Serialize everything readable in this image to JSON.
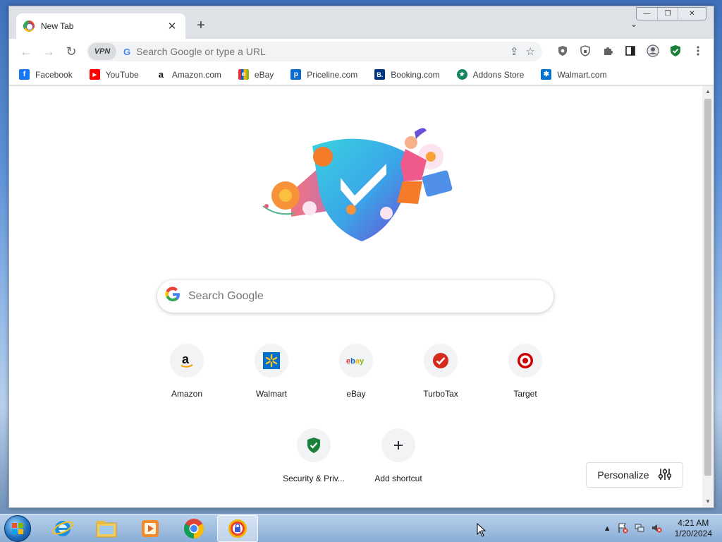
{
  "window": {
    "controls": {
      "minimize": "—",
      "restore": "❐",
      "close": "✕"
    }
  },
  "tab": {
    "title": "New Tab",
    "close": "✕"
  },
  "new_tab_label": "+",
  "tab_list_label": "⌄",
  "toolbar": {
    "back": "←",
    "forward": "→",
    "reload": "↻",
    "vpn_label": "VPN",
    "omnibox_placeholder": "Search Google or type a URL",
    "share_icon": "⇪",
    "star_icon": "☆"
  },
  "bookmarks": [
    {
      "label": "Facebook",
      "icon": "f",
      "color": "#1877f2"
    },
    {
      "label": "YouTube",
      "icon": "▶",
      "color": "#ff0000"
    },
    {
      "label": "Amazon.com",
      "icon": "a",
      "color": "#ffffff"
    },
    {
      "label": "eBay",
      "icon": "e",
      "color": "#e53238"
    },
    {
      "label": "Priceline.com",
      "icon": "p",
      "color": "#0a6ccf"
    },
    {
      "label": "Booking.com",
      "icon": "B.",
      "color": "#003580"
    },
    {
      "label": "Addons Store",
      "icon": "★",
      "color": "#14845b"
    },
    {
      "label": "Walmart.com",
      "icon": "✱",
      "color": "#0071ce"
    }
  ],
  "search": {
    "placeholder": "Search Google",
    "logo": "G"
  },
  "shortcuts": [
    {
      "label": "Amazon"
    },
    {
      "label": "Walmart"
    },
    {
      "label": "eBay"
    },
    {
      "label": "TurboTax"
    },
    {
      "label": "Target"
    },
    {
      "label": "Security & Priv..."
    },
    {
      "label": "Add shortcut"
    }
  ],
  "personalize": {
    "label": "Personalize"
  },
  "taskbar": {
    "clock_time": "4:21 AM",
    "clock_date": "1/20/2024"
  },
  "colors": {
    "accent": "#1a73e8",
    "shield_green": "#188038"
  }
}
